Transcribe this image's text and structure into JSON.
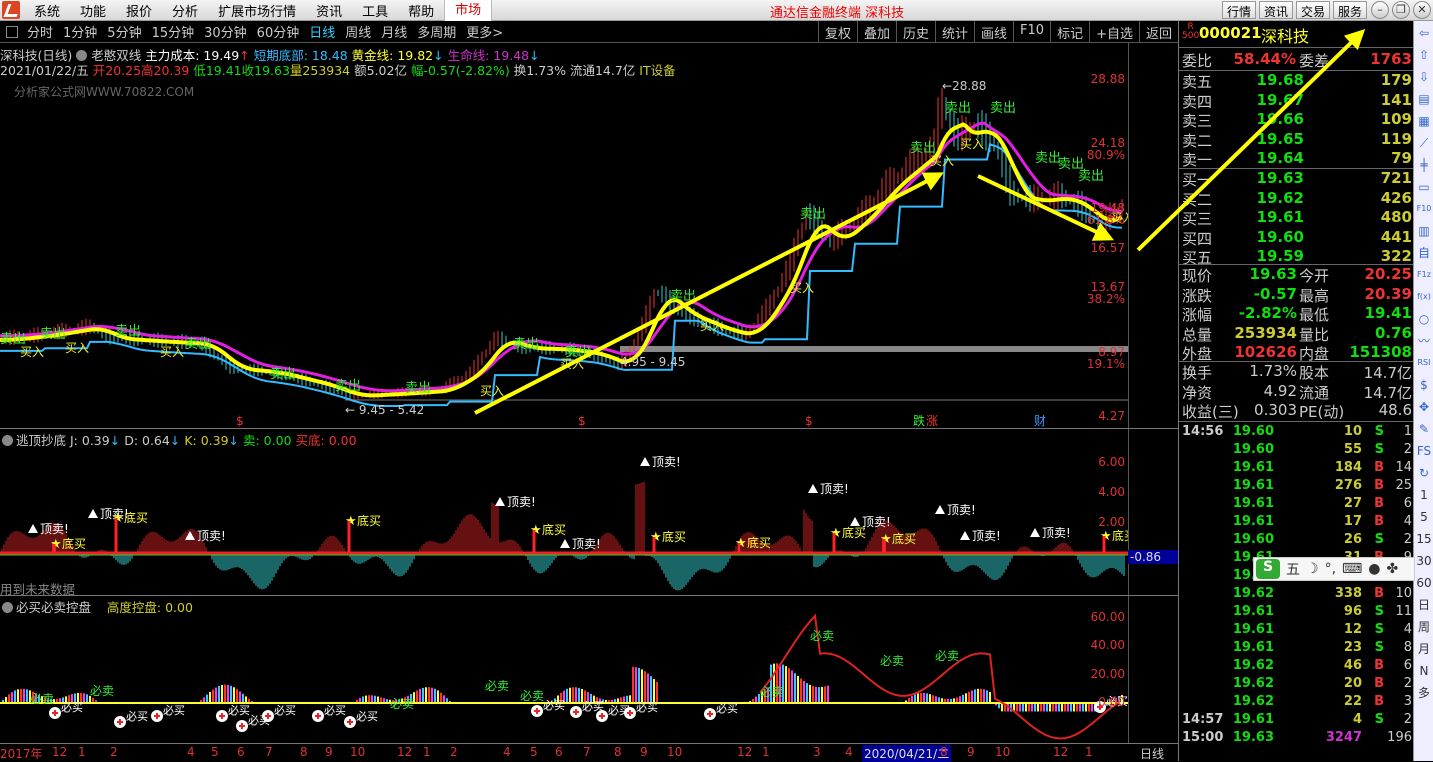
{
  "menu": {
    "items": [
      "系统",
      "功能",
      "报价",
      "分析",
      "扩展市场行情",
      "资讯",
      "工具",
      "帮助"
    ],
    "market_tab": "市场",
    "app_title": "通达信金融终端  深科技",
    "right_buttons": [
      "行情",
      "资讯",
      "交易",
      "服务"
    ],
    "window_buttons": [
      "minimize",
      "restore",
      "close"
    ]
  },
  "periods": {
    "items": [
      "分时",
      "1分钟",
      "5分钟",
      "15分钟",
      "30分钟",
      "60分钟",
      "日线",
      "周线",
      "月线",
      "多周期",
      "更多>"
    ],
    "active": "日线",
    "tools": [
      "复权",
      "叠加",
      "历史",
      "统计",
      "画线",
      "F10",
      "标记",
      "+自选",
      "返回"
    ]
  },
  "main": {
    "title": "深科技(日线)",
    "formula": "老憨双线",
    "zlcb_label": "主力成本: 19.49",
    "dqdb_label": "短期底部: 18.48",
    "hjx_label": "黄金线: 19.82",
    "smx_label": "生命线: 19.48",
    "date": "2021/01/22/五",
    "open": "开20.25",
    "high": "高20.39",
    "low": "低19.41",
    "close": "收19.63",
    "vol": "量253934",
    "amount": "额5.02亿",
    "change": "幅-0.57(-2.82%)",
    "turnover": "换1.73%",
    "float": "流通14.7亿",
    "sector": "IT设备",
    "watermark": "分析家公式网WWW.70822.COM",
    "high_mark": "28.88",
    "range1": "9.45 - 5.42",
    "range2": "4.95 - 9.45",
    "signals": {
      "sell": "卖出",
      "buy": "买入"
    },
    "event_marks": [
      "$",
      "$",
      "跌",
      "$",
      "涨",
      "财"
    ]
  },
  "price_chart": {
    "type": "line",
    "y_ticks": [
      "28.88",
      "24.18",
      "19.48",
      "16.57",
      "13.67",
      "8.97",
      "4.27"
    ],
    "pct_ticks": [
      "80.9%",
      "61.8%",
      "38.2%",
      "19.1%"
    ],
    "ylim": [
      4.27,
      28.88
    ],
    "close": [
      [
        0,
        9.9
      ],
      [
        40,
        10.2
      ],
      [
        90,
        10.8
      ],
      [
        110,
        10.0
      ],
      [
        150,
        9.8
      ],
      [
        200,
        9.6
      ],
      [
        230,
        7.8
      ],
      [
        270,
        7.5
      ],
      [
        320,
        6.6
      ],
      [
        350,
        5.8
      ],
      [
        400,
        6.0
      ],
      [
        440,
        6.2
      ],
      [
        470,
        7.5
      ],
      [
        495,
        10.0
      ],
      [
        520,
        9.3
      ],
      [
        560,
        9.2
      ],
      [
        590,
        8.9
      ],
      [
        620,
        8.0
      ],
      [
        640,
        10.5
      ],
      [
        655,
        13.5
      ],
      [
        680,
        11.8
      ],
      [
        720,
        10.6
      ],
      [
        745,
        10.2
      ],
      [
        770,
        12.5
      ],
      [
        790,
        15.5
      ],
      [
        805,
        19.0
      ],
      [
        830,
        17.0
      ],
      [
        860,
        18.8
      ],
      [
        885,
        21.0
      ],
      [
        910,
        22.5
      ],
      [
        935,
        24.0
      ],
      [
        940,
        27.5
      ],
      [
        955,
        24.5
      ],
      [
        975,
        25.5
      ],
      [
        995,
        24.0
      ],
      [
        1010,
        20.5
      ],
      [
        1030,
        20.0
      ],
      [
        1060,
        20.3
      ],
      [
        1080,
        19.5
      ],
      [
        1100,
        18.2
      ],
      [
        1120,
        19.6
      ]
    ]
  },
  "ind1": {
    "name": "逃顶抄底",
    "j": "J: 0.39",
    "d": "D: 0.64",
    "k": "K: 0.39",
    "sell": "卖: 0.00",
    "buybottom": "买底: 0.00",
    "y_ticks": [
      "6.00",
      "4.00",
      "2.00"
    ],
    "current": "-0.86",
    "note": "用到未来数据",
    "top_sell": "顶卖!",
    "bottom_buy": "底买"
  },
  "ind2": {
    "name": "必买必卖控盘",
    "height_label": "高度控盘: 0.00",
    "y_ticks": [
      "60.00",
      "40.00",
      "20.00",
      "0.00"
    ],
    "must_buy": "必买",
    "must_sell": "必卖"
  },
  "time_axis": {
    "labels": [
      "2017年",
      "12",
      "1",
      "2",
      "4",
      "5",
      "6",
      "7",
      "8",
      "9",
      "10",
      "12",
      "1",
      "2",
      "4",
      "5",
      "6",
      "7",
      "8",
      "9",
      "10",
      "12",
      "1",
      "3",
      "4",
      "2020/04/21/二",
      "8",
      "9",
      "10",
      "12",
      "1"
    ],
    "period": "日线"
  },
  "quote": {
    "r_badge": "R",
    "r_num": "500",
    "code": "000021",
    "name": "深科技",
    "wb_label": "委比",
    "wb": "58.44%",
    "wc_label": "委差",
    "wc": "1763",
    "asks": [
      [
        "卖五",
        "19.68",
        "179"
      ],
      [
        "卖四",
        "19.67",
        "141"
      ],
      [
        "卖三",
        "19.66",
        "109"
      ],
      [
        "卖二",
        "19.65",
        "119"
      ],
      [
        "卖一",
        "19.64",
        "79"
      ]
    ],
    "bids": [
      [
        "买一",
        "19.63",
        "721"
      ],
      [
        "买二",
        "19.62",
        "426"
      ],
      [
        "买三",
        "19.61",
        "480"
      ],
      [
        "买四",
        "19.60",
        "441"
      ],
      [
        "买五",
        "19.59",
        "322"
      ]
    ],
    "stats": [
      [
        "现价",
        "19.63",
        "今开",
        "20.25"
      ],
      [
        "涨跌",
        "-0.57",
        "最高",
        "20.39"
      ],
      [
        "涨幅",
        "-2.82%",
        "最低",
        "19.41"
      ],
      [
        "总量",
        "253934",
        "量比",
        "0.76"
      ],
      [
        "外盘",
        "102626",
        "内盘",
        "151308"
      ]
    ],
    "fin": [
      [
        "换手",
        "1.73%",
        "股本",
        "14.7亿"
      ],
      [
        "净资",
        "4.92",
        "流通",
        "14.7亿"
      ],
      [
        "收益(三)",
        "0.303",
        "PE(动)",
        "48.6"
      ]
    ],
    "ticks": [
      [
        "14:56",
        "19.60",
        "10",
        "S",
        "1"
      ],
      [
        "",
        "19.60",
        "55",
        "S",
        "2"
      ],
      [
        "",
        "19.61",
        "184",
        "B",
        "14"
      ],
      [
        "",
        "19.61",
        "276",
        "B",
        "25"
      ],
      [
        "",
        "19.61",
        "27",
        "B",
        "6"
      ],
      [
        "",
        "19.61",
        "17",
        "B",
        "4"
      ],
      [
        "",
        "19.60",
        "26",
        "S",
        "2"
      ],
      [
        "",
        "19.61",
        "31",
        "B",
        "9"
      ],
      [
        "",
        "19.61",
        "49",
        "S",
        "1"
      ],
      [
        "",
        "19.62",
        "338",
        "B",
        "10"
      ],
      [
        "",
        "19.61",
        "96",
        "S",
        "11"
      ],
      [
        "",
        "19.61",
        "12",
        "S",
        "4"
      ],
      [
        "",
        "19.61",
        "23",
        "S",
        "8"
      ],
      [
        "",
        "19.62",
        "46",
        "B",
        "6"
      ],
      [
        "",
        "19.62",
        "20",
        "B",
        "2"
      ],
      [
        "",
        "19.62",
        "22",
        "B",
        "3"
      ],
      [
        "14:57",
        "19.61",
        "4",
        "S",
        "2"
      ],
      [
        "15:00",
        "19.63",
        "3247",
        "",
        "196"
      ]
    ]
  },
  "ime": {
    "logo": "S",
    "mode": "五"
  },
  "side_tools": [
    "1",
    "5",
    "15",
    "30",
    "60",
    "日",
    "周",
    "月",
    "N",
    "多"
  ],
  "colors": {
    "up": "#e33",
    "down": "#1d1",
    "gold": "#ffff00",
    "life": "#e020e0",
    "bottom": "#33bbff",
    "arrow": "#ffff00"
  }
}
